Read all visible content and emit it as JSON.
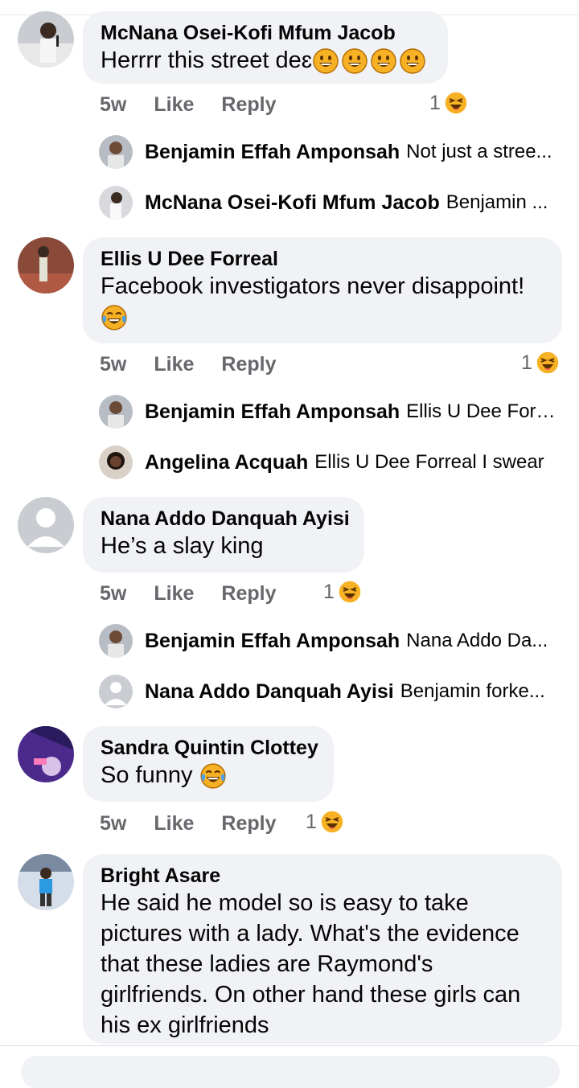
{
  "colors": {
    "bubble_bg": "#f0f2f5",
    "meta_text": "#65676b",
    "name_text": "#050505",
    "haha_yellow": "#f7b125"
  },
  "comments": [
    {
      "author": "McNana Osei-Kofi Mfum Jacob",
      "text": "Herrrr this street deɛ",
      "emoji_after": [
        "grinning-emoji",
        "grinning-emoji",
        "grinning-emoji",
        "grinning-emoji"
      ],
      "time": "5w",
      "like": "Like",
      "reply": "Reply",
      "reaction_count": "1",
      "reaction_icon": "haha-icon",
      "replies": [
        {
          "author": "Benjamin Effah Amponsah",
          "text": "Not just a stree..."
        },
        {
          "author": "McNana Osei-Kofi Mfum Jacob",
          "text": "Benjamin ..."
        }
      ]
    },
    {
      "author": "Ellis U Dee Forreal",
      "text": "Facebook investigators never disappoint!",
      "emoji_after": [
        "tears-of-joy-emoji"
      ],
      "time": "5w",
      "like": "Like",
      "reply": "Reply",
      "reaction_count": "1",
      "reaction_icon": "haha-icon",
      "replies": [
        {
          "author": "Benjamin Effah Amponsah",
          "text": "Ellis U Dee Forr..."
        },
        {
          "author": "Angelina Acquah",
          "text": "Ellis U Dee Forreal I swear"
        }
      ]
    },
    {
      "author": "Nana Addo Danquah Ayisi",
      "text": "He’s a slay king",
      "time": "5w",
      "like": "Like",
      "reply": "Reply",
      "reaction_count": "1",
      "reaction_icon": "haha-icon",
      "replies": [
        {
          "author": "Benjamin Effah Amponsah",
          "text": "Nana Addo Da..."
        },
        {
          "author": "Nana Addo Danquah Ayisi",
          "text": "Benjamin forke..."
        }
      ]
    },
    {
      "author": "Sandra Quintin Clottey",
      "text": "So funny",
      "emoji_after": [
        "tears-of-joy-emoji"
      ],
      "time": "5w",
      "like": "Like",
      "reply": "Reply",
      "reaction_count": "1",
      "reaction_icon": "haha-icon"
    },
    {
      "author": "Bright Asare",
      "text": "He said he model so is easy to take pictures with a lady. What's the evidence that these ladies are Raymond's girlfriends. On other hand these girls can his ex girlfriends"
    }
  ]
}
